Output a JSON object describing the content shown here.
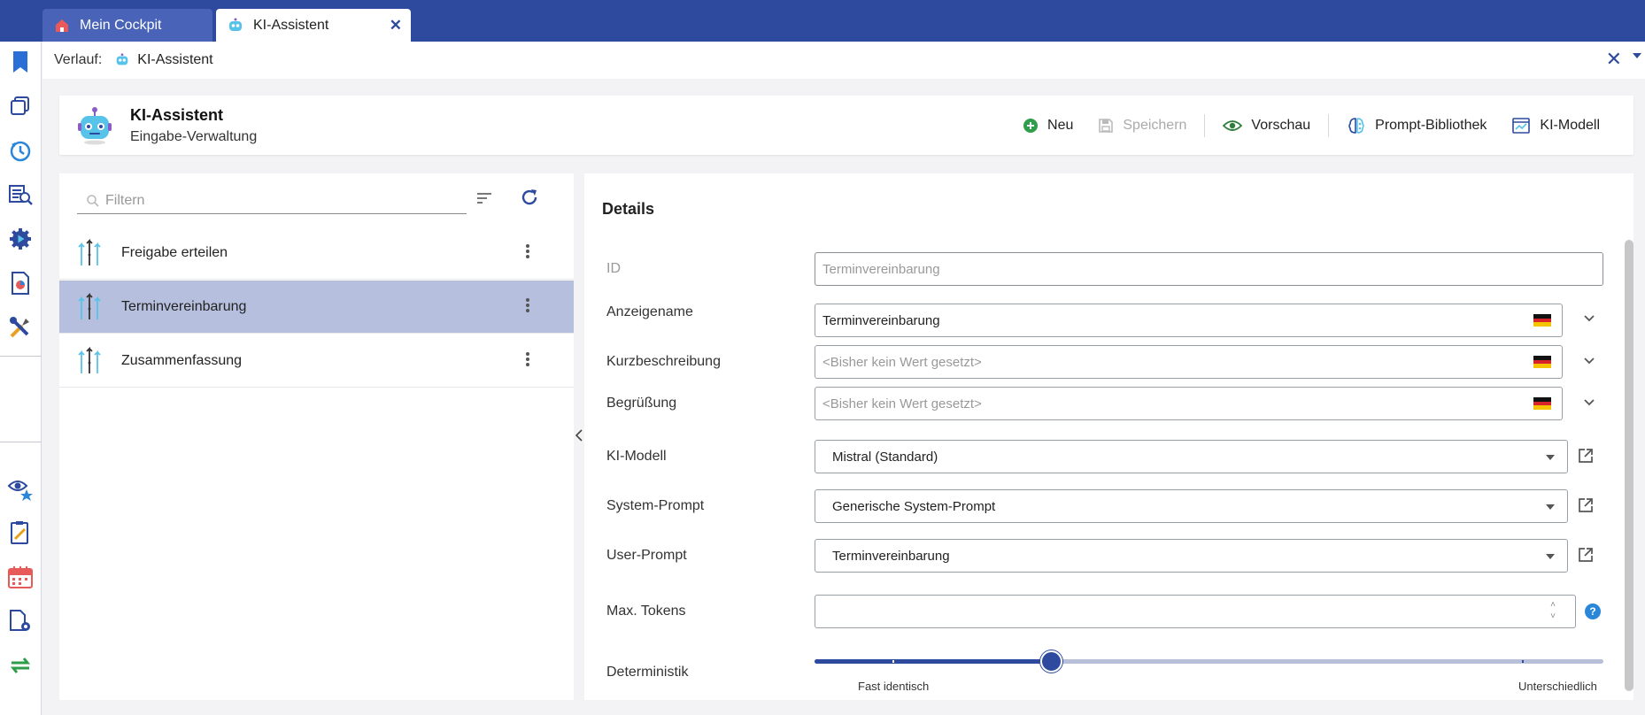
{
  "tabs": [
    {
      "label": "Mein Cockpit",
      "icon": "home-icon",
      "active": false
    },
    {
      "label": "KI-Assistent",
      "icon": "robot-icon",
      "active": true
    }
  ],
  "breadcrumb": {
    "label": "Verlauf:",
    "item": "KI-Assistent"
  },
  "header": {
    "title": "KI-Assistent",
    "subtitle": "Eingabe-Verwaltung",
    "toolbar": {
      "new": "Neu",
      "save": "Speichern",
      "preview": "Vorschau",
      "prompt_library": "Prompt-Bibliothek",
      "ai_model": "KI-Modell"
    }
  },
  "list": {
    "filter_placeholder": "Filtern",
    "items": [
      {
        "label": "Freigabe erteilen",
        "selected": false
      },
      {
        "label": "Terminvereinbarung",
        "selected": true
      },
      {
        "label": "Zusammenfassung",
        "selected": false
      }
    ]
  },
  "details": {
    "heading": "Details",
    "fields": {
      "id": {
        "label": "ID",
        "value": "Terminvereinbarung"
      },
      "display_name": {
        "label": "Anzeigename",
        "value": "Terminvereinbarung"
      },
      "short_desc": {
        "label": "Kurzbeschreibung",
        "value": "<Bisher kein Wert gesetzt>"
      },
      "greeting": {
        "label": "Begrüßung",
        "value": "<Bisher kein Wert gesetzt>"
      },
      "ai_model": {
        "label": "KI-Modell",
        "value": "Mistral (Standard)"
      },
      "system_prompt": {
        "label": "System-Prompt",
        "value": "Generische System-Prompt"
      },
      "user_prompt": {
        "label": "User-Prompt",
        "value": "Terminvereinbarung"
      },
      "max_tokens": {
        "label": "Max. Tokens",
        "value": ""
      },
      "determinism": {
        "label": "Deterministik",
        "left_label": "Fast identisch",
        "right_label": "Unterschiedlich",
        "level": 0.3
      }
    }
  },
  "colors": {
    "brand": "#2e4a9e",
    "selected_row": "#b6c0de",
    "help": "#2a86d8"
  }
}
